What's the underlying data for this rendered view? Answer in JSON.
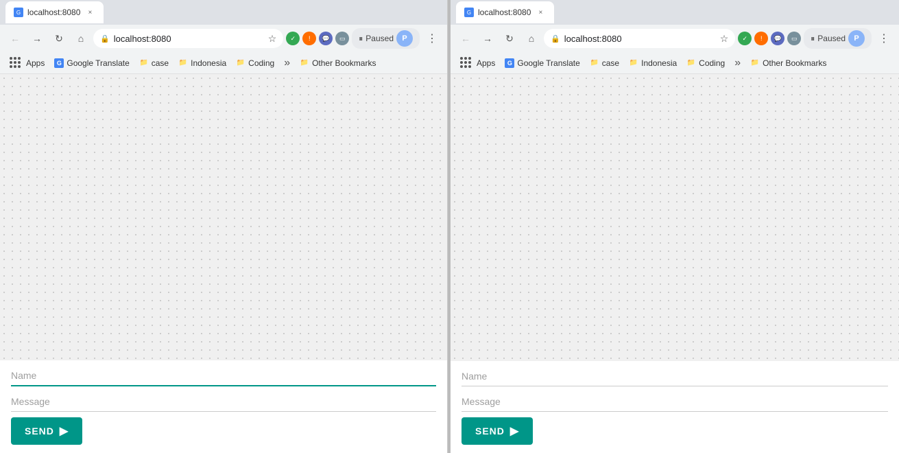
{
  "left_window": {
    "tab": {
      "favicon": "G",
      "label": "localhost:8080",
      "close": "×"
    },
    "address_bar": {
      "url": "localhost:8080",
      "status": "Paused"
    },
    "bookmarks": [
      {
        "id": "apps",
        "label": "Apps",
        "icon": "grid"
      },
      {
        "id": "google-translate",
        "label": "Google Translate",
        "icon": "G"
      },
      {
        "id": "case",
        "label": "case",
        "icon": "folder"
      },
      {
        "id": "indonesia",
        "label": "Indonesia",
        "icon": "folder"
      },
      {
        "id": "coding",
        "label": "Coding",
        "icon": "folder"
      },
      {
        "id": "more",
        "label": "»",
        "icon": ""
      },
      {
        "id": "other-bookmarks",
        "label": "Other Bookmarks",
        "icon": "folder"
      }
    ],
    "form": {
      "name_placeholder": "Name",
      "message_placeholder": "Message",
      "send_button": "SEND"
    }
  },
  "right_window": {
    "tab": {
      "favicon": "G",
      "label": "localhost:8080",
      "close": "×"
    },
    "address_bar": {
      "url": "localhost:8080",
      "status": "Paused"
    },
    "bookmarks": [
      {
        "id": "apps",
        "label": "Apps",
        "icon": "grid"
      },
      {
        "id": "google-translate",
        "label": "Google Translate",
        "icon": "G"
      },
      {
        "id": "case",
        "label": "case",
        "icon": "folder"
      },
      {
        "id": "indonesia",
        "label": "Indonesia",
        "icon": "folder"
      },
      {
        "id": "coding",
        "label": "Coding",
        "icon": "folder"
      },
      {
        "id": "more",
        "label": "»",
        "icon": ""
      },
      {
        "id": "other-bookmarks",
        "label": "Other Bookmarks",
        "icon": "folder"
      }
    ],
    "form": {
      "name_placeholder": "Name",
      "message_placeholder": "Message",
      "send_button": "SEND"
    }
  },
  "icons": {
    "back": "←",
    "forward": "→",
    "reload": "↻",
    "home": "⌂",
    "lock": "🔒",
    "star": "☆",
    "paused": "⏸",
    "menu": "⋮",
    "folder": "📁",
    "send_arrow": "▶"
  }
}
